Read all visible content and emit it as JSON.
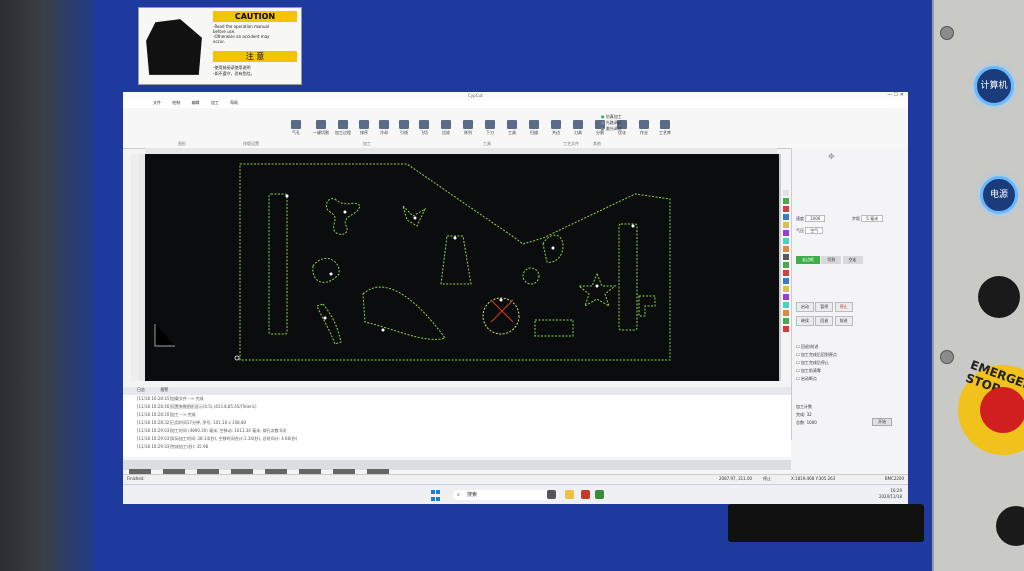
{
  "machine": {
    "sticker": {
      "caution": "CAUTION",
      "lines": [
        "-Read the operation manual",
        " before use.",
        "-Otherwise an accident may",
        " occur."
      ],
      "zh_title": "注 意",
      "zh_lines": [
        "-使用前阅读使用说明",
        "-如不遵守，恐有危险。"
      ]
    },
    "buttons": {
      "computer": "计算机",
      "power": "电源"
    },
    "emergency_label": "EMERGENCY STOP"
  },
  "app": {
    "menu": [
      "文件",
      "绘制",
      "编辑",
      "加工",
      "帮助"
    ],
    "ribbon": {
      "items": [
        "气孔",
        "一键切割",
        "加工过程",
        "排序",
        "冷却",
        "引线",
        "飞切",
        "比较",
        "阵列",
        "下刀",
        "工具",
        "扫描",
        "共边",
        "刀具",
        "分割",
        "优化",
        "作业",
        "工艺库"
      ],
      "groups": [
        "图形",
        "排版设置",
        "加工",
        "工具",
        "工艺文件",
        "其他"
      ],
      "status": [
        "仿真加工",
        "光路调试",
        "激光调试"
      ]
    },
    "tabs": [
      "日志",
      "报警"
    ],
    "log_lines": [
      "[11/18 16:28:15]加载文件 --> 完成",
      "[11/18 16:28:16]设置参数图形显示(0.5),(413.8,85.45/(Teleric)",
      "[11/18 16:28:20]加工 --> 完成",
      "[11/18 16:28:32]已用时间17分钟, 序号: 101.16 x 108.80",
      "[11/18 16:29:03]加工时间 (4890.30) 毫米, 空移动: 1011.34 毫米, 穿孔次数:6次",
      "[11/18 16:29:03]实际加工时间: 28:14(秒), 空移时间合计:1.34(秒), 总时间计: 4.66(秒)",
      "[11/18 16:29:33]完成加工(秒): 35.98"
    ],
    "status_bar": {
      "left": "Finished.",
      "coords": "2087.97, 311.00",
      "state": "停止",
      "pos": "X:1819.468 Y:305.263",
      "right": "BMC2200"
    },
    "side_panel": {
      "speed_label": "速度",
      "speed": "1000",
      "step_label": "步距",
      "step": "5 毫米",
      "gas_label": "气压",
      "gas": "空气",
      "frame_label": "走边框",
      "cut_label": "切割",
      "dry_run": "空走",
      "buttons": [
        "启动",
        "暂停",
        "停止",
        "继续",
        "回退",
        "前进"
      ],
      "checkboxes": [
        "回退/前进",
        "加工完成后回到原点",
        "加工完成后停止",
        "加工前清零",
        "启动断点"
      ],
      "counts_title": "加工计数",
      "counts": [
        {
          "label": "完成",
          "value": "32"
        },
        {
          "label": "总数",
          "value": "1000"
        }
      ],
      "start_btn": "开始"
    },
    "taskbar": {
      "search": "搜索",
      "time": "16:29",
      "date": "2020/11/18"
    },
    "accent": "#2a8bd8",
    "cut_color": "#8fd24a",
    "canvas_bg": "#0b0c0d"
  }
}
